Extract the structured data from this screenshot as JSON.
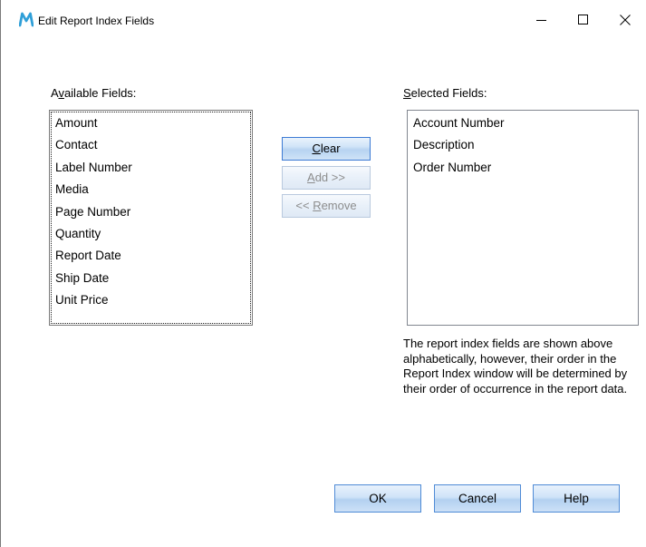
{
  "window": {
    "title": "Edit Report Index Fields",
    "icon": "m-logo-icon",
    "controls": {
      "minimize": "minimize-icon",
      "maximize": "maximize-icon",
      "close": "close-icon"
    }
  },
  "available": {
    "label_pre": "A",
    "label_accel": "v",
    "label_post": "ailable Fields:",
    "items": [
      "Amount",
      "Contact",
      "Label Number",
      "Media",
      "Page Number",
      "Quantity",
      "Report Date",
      "Ship Date",
      "Unit Price"
    ]
  },
  "selected": {
    "label_accel": "S",
    "label_post": "elected Fields:",
    "items": [
      "Account Number",
      "Description",
      "Order Number"
    ]
  },
  "actions": {
    "clear_accel": "C",
    "clear_post": "lear",
    "add_accel": "A",
    "add_post": "dd >>",
    "remove_pre": "<< ",
    "remove_accel": "R",
    "remove_post": "emove"
  },
  "info": "The report index fields are shown above alphabetically, however, their order in the Report Index window will be determined by their order of occurrence in the report data.",
  "footer": {
    "ok": "OK",
    "cancel": "Cancel",
    "help": "Help"
  },
  "colors": {
    "logo": "#2f9fd8",
    "button_border": "#4f8bd6",
    "disabled_text": "#8d8d8d"
  }
}
